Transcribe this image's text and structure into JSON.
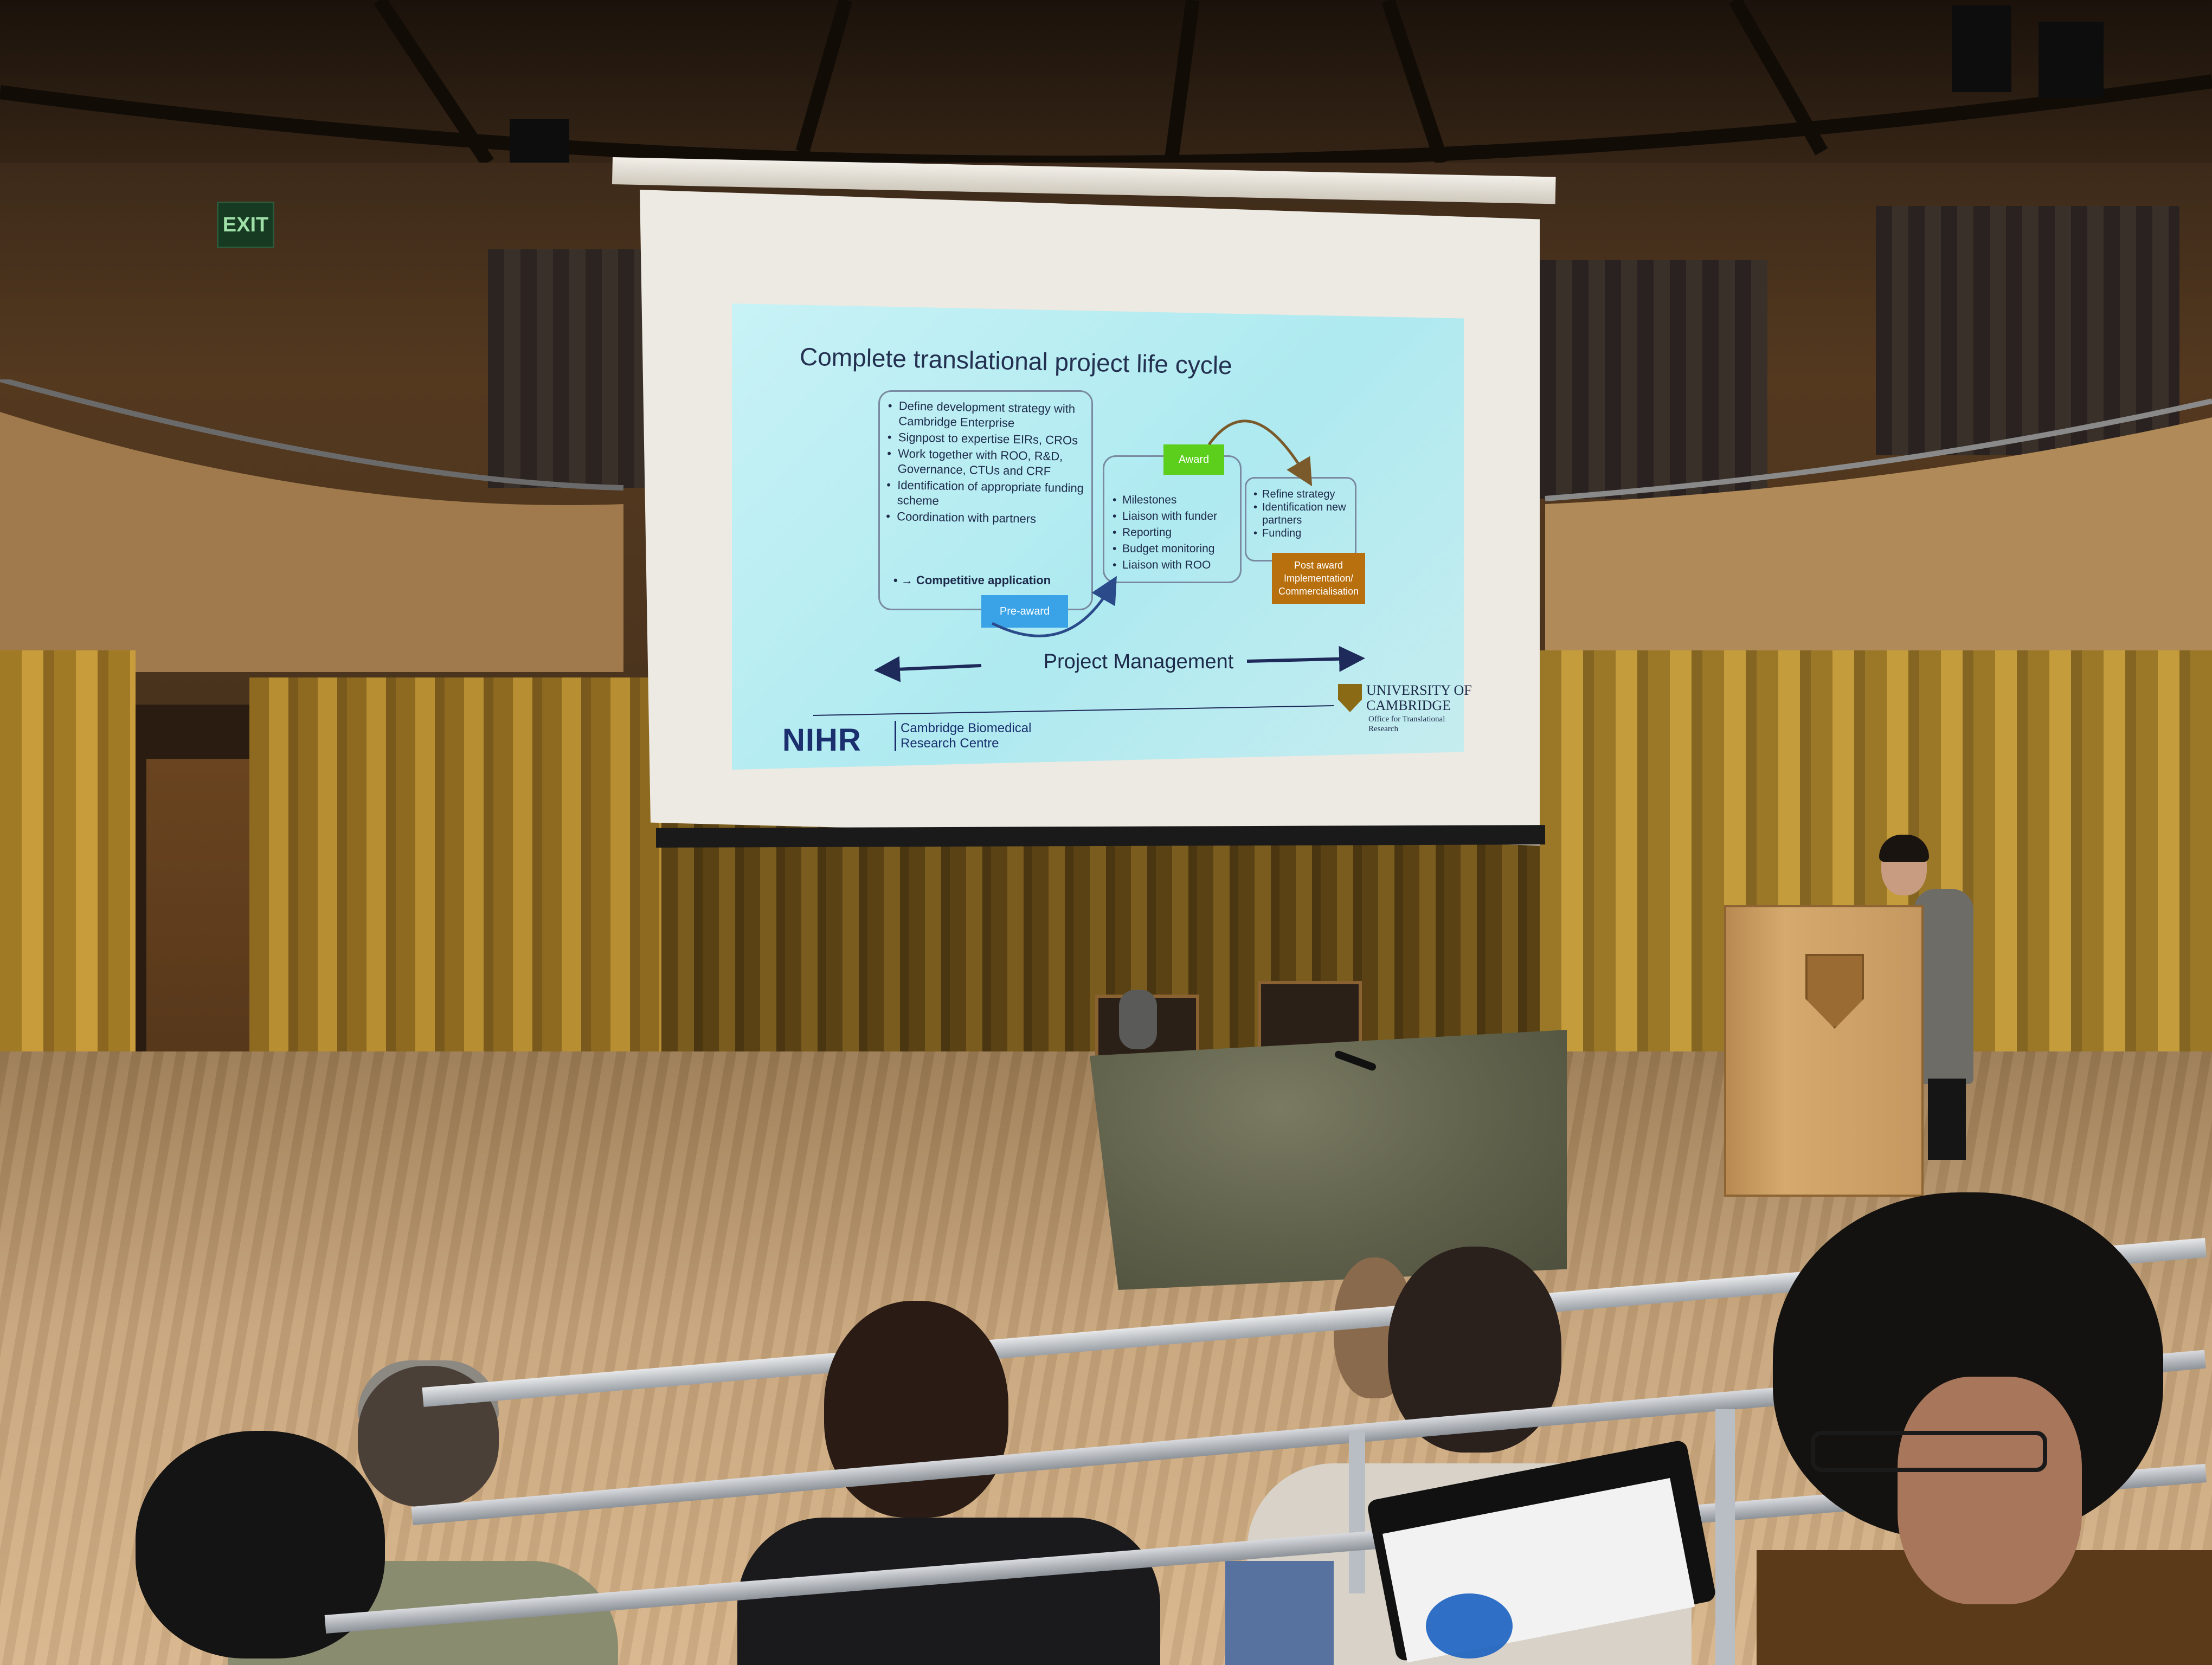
{
  "room": {
    "exit_sign": "EXIT"
  },
  "slide": {
    "title": "Complete translational project life cycle",
    "pre_award": {
      "items": [
        "Define development strategy with Cambridge Enterprise",
        "Signpost to expertise EIRs, CROs",
        "Work together with ROO, R&D, Governance, CTUs and CRF",
        "Identification of appropriate funding scheme",
        "Coordination with partners"
      ],
      "competitive": "• → Competitive application",
      "tag": "Pre-award"
    },
    "award": {
      "tag": "Award",
      "items": [
        "Milestones",
        "Liaison with funder",
        "Reporting",
        "Budget monitoring",
        "Liaison with ROO"
      ]
    },
    "post_award": {
      "items": [
        "Refine strategy",
        "Identification new partners",
        "Funding"
      ],
      "tag": "Post award Implementation/ Commercialisation"
    },
    "project_management": "Project Management",
    "nihr": "NIHR",
    "nihr_sub": "Cambridge Biomedical Research Centre",
    "university": "UNIVERSITY OF CAMBRIDGE",
    "university_dept": "Office for Translational Research",
    "colors": {
      "pre_award_tag": "#3aa3e8",
      "award_tag": "#5ccf1c",
      "post_award_tag": "#b86f0e",
      "nihr_blue": "#1b2f6e"
    }
  }
}
